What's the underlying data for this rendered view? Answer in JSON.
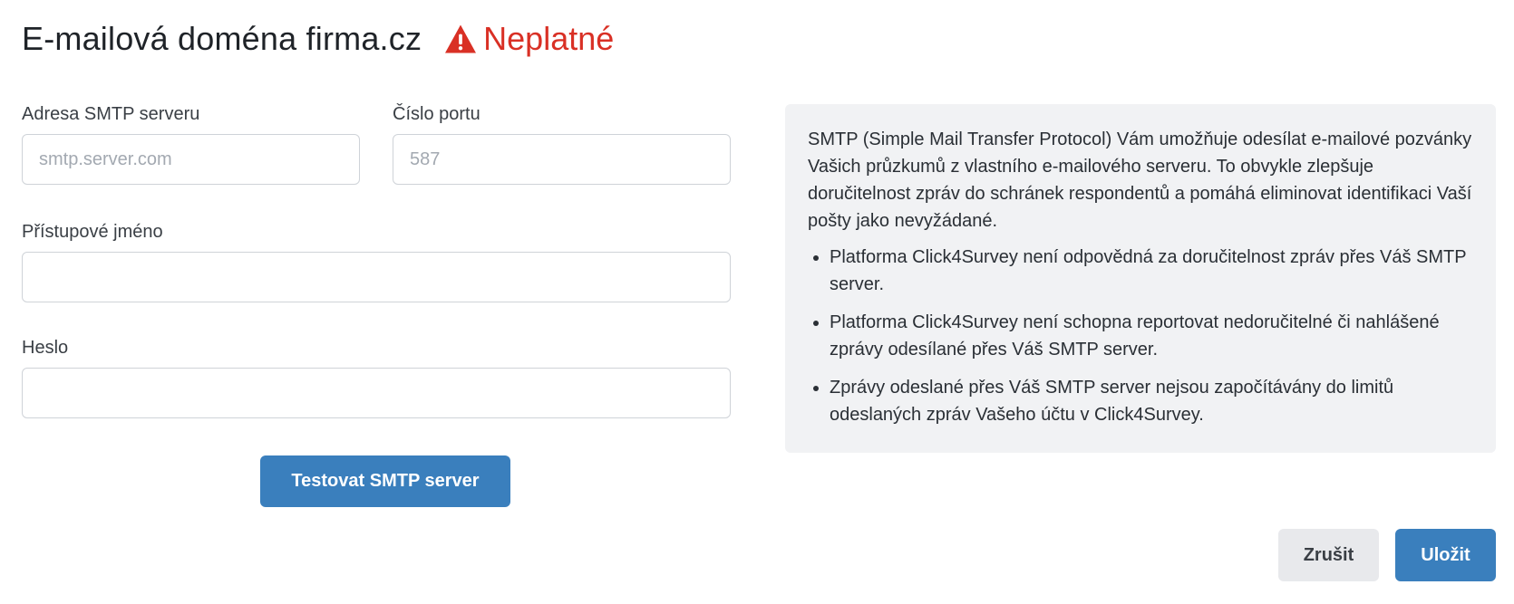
{
  "header": {
    "title": "E-mailová doména firma.cz",
    "status_label": "Neplatné",
    "status_icon": "warning-triangle-icon",
    "status_color": "#d93025"
  },
  "form": {
    "smtp_server": {
      "label": "Adresa SMTP serveru",
      "value": "",
      "placeholder": "smtp.server.com"
    },
    "port": {
      "label": "Číslo portu",
      "value": "",
      "placeholder": "587"
    },
    "username": {
      "label": "Přístupové jméno",
      "value": "",
      "placeholder": ""
    },
    "password": {
      "label": "Heslo",
      "value": "",
      "placeholder": ""
    },
    "test_button": "Testovat SMTP server"
  },
  "info": {
    "intro": "SMTP (Simple Mail Transfer Protocol) Vám umožňuje odesílat e-mailové pozvánky Vašich průzkumů z vlastního e-mailového serveru. To obvykle zlepšuje doručitelnost zpráv do schránek respondentů a pomáhá eliminovat identifikaci Vaší pošty jako nevyžádané.",
    "bullets": [
      "Platforma Click4Survey není odpovědná za doručitelnost zpráv přes Váš SMTP server.",
      "Platforma Click4Survey není schopna reportovat nedoručitelné či nahlášené zprávy odesílané přes Váš SMTP server.",
      "Zprávy odeslané přes Váš SMTP server nejsou započítávány do limitů odeslaných zpráv Vašeho účtu v Click4Survey."
    ]
  },
  "footer": {
    "cancel_label": "Zrušit",
    "save_label": "Uložit"
  },
  "colors": {
    "primary": "#3a7fbd",
    "error": "#d93025",
    "info_bg": "#f1f2f4"
  }
}
